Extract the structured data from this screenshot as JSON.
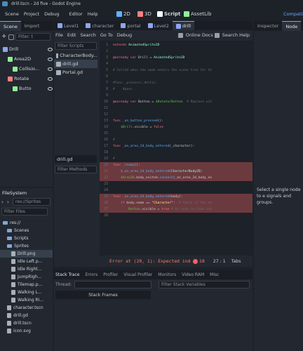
{
  "window": {
    "title": "drill.tscn - 2d five - Godot Engine"
  },
  "menu": [
    "Scene",
    "Project",
    "Debug",
    "Editor",
    "Help"
  ],
  "workspaces": [
    {
      "label": "2D",
      "color": "#5fb2ff"
    },
    {
      "label": "3D",
      "color": "#fc7f7f"
    },
    {
      "label": "Script",
      "color": "#ffffff"
    },
    {
      "label": "AssetLib",
      "color": "#8eef97"
    }
  ],
  "renderer": "Compatibi",
  "scene_dock": {
    "tabs": [
      "Scene",
      "Import"
    ],
    "filter_placeholder": "Filter: t",
    "nodes": [
      {
        "name": "Drill",
        "indent": 0,
        "color": "#8da5f3"
      },
      {
        "name": "Area2D",
        "indent": 1,
        "color": "#8eef97"
      },
      {
        "name": "Collisio...",
        "indent": 2,
        "color": "#8eef97"
      },
      {
        "name": "Rotate",
        "indent": 1,
        "color": "#fc7f7f"
      },
      {
        "name": "Butto",
        "indent": 2,
        "color": "#8eef97"
      }
    ]
  },
  "filesystem": {
    "title": "FileSystem",
    "path": "res://Sprites",
    "filter_placeholder": "Filter Files",
    "items": [
      {
        "name": "res://",
        "indent": 0,
        "kind": "folder"
      },
      {
        "name": "Scenes",
        "indent": 1,
        "kind": "folder"
      },
      {
        "name": "Scripts",
        "indent": 1,
        "kind": "folder"
      },
      {
        "name": "Sprites",
        "indent": 1,
        "kind": "folder"
      },
      {
        "name": "Drill.png",
        "indent": 2,
        "kind": "file",
        "selected": true
      },
      {
        "name": "Idle Left.p...",
        "indent": 2,
        "kind": "file"
      },
      {
        "name": "Idle Right...",
        "indent": 2,
        "kind": "file"
      },
      {
        "name": "JumpRigh...",
        "indent": 2,
        "kind": "file"
      },
      {
        "name": "Tilemap.p...",
        "indent": 2,
        "kind": "file"
      },
      {
        "name": "Walking L...",
        "indent": 2,
        "kind": "file"
      },
      {
        "name": "Walking Ri...",
        "indent": 2,
        "kind": "file"
      },
      {
        "name": "character.tscn",
        "indent": 1,
        "kind": "file"
      },
      {
        "name": "drill.gd",
        "indent": 1,
        "kind": "file"
      },
      {
        "name": "drill.tscn",
        "indent": 1,
        "kind": "file"
      },
      {
        "name": "icon.svg",
        "indent": 1,
        "kind": "file"
      }
    ]
  },
  "scene_tabs": [
    "Level1",
    "character",
    "portal",
    "Level2",
    "drill"
  ],
  "script_menu": [
    "File",
    "Edit",
    "Search",
    "Go To",
    "Debug"
  ],
  "online_docs": "Online Docs",
  "search_help": "Search Help",
  "filter_scripts": "Filter Scripts",
  "scripts": [
    {
      "name": "CharacterBody..."
    },
    {
      "name": "drill.gd",
      "selected": true
    },
    {
      "name": "Portal.gd"
    }
  ],
  "current_script": "drill.gd",
  "filter_methods": "Filter Methods",
  "code_lines": [
    {
      "n": "1",
      "html": "<span class='kw'>extends</span> <span class='ty'>AnimatedSprite2D</span>"
    },
    {
      "n": "2",
      "html": ""
    },
    {
      "n": "3",
      "html": "<span class='kw'>@onready</span> <span class='kw'>var</span> Drill = <span class='ty'>AnimatedSprite2D</span>"
    },
    {
      "n": "4",
      "html": ""
    },
    {
      "n": "5",
      "html": "<span class='cm'># Called when the node enters the scene tree for th</span>"
    },
    {
      "n": "6",
      "html": ""
    },
    {
      "n": "7",
      "html": "<span class='cm'>#func _process(_delta):</span>"
    },
    {
      "n": "8",
      "html": "<span class='cm'>#    #pass</span>"
    },
    {
      "n": "9",
      "html": ""
    },
    {
      "n": "10",
      "html": "<span class='kw'>@onready</span> <span class='kw'>var</span> Button = <span class='nd'>$Rotate/Button</span>  <span class='cm'># Replace wit</span>"
    },
    {
      "n": "11",
      "html": ""
    },
    {
      "n": "12",
      "html": ""
    },
    {
      "n": "13",
      "html": "<span class='kw'>func</span> <span class='fn'>_on_button_pressed</span>():"
    },
    {
      "n": "14",
      "html": "    <span class='nd'>$Drill</span>.visible = <span class='kw'>false</span>"
    },
    {
      "n": "15",
      "html": ""
    },
    {
      "n": "16",
      "html": "<span class='cm'>#</span>"
    },
    {
      "n": "17",
      "html": "<span class='kw'>func</span> <span class='fn'>_on_area_2d_body_entered</span>(_character):"
    },
    {
      "n": "18",
      "html": ""
    },
    {
      "n": "19",
      "html": "<span class='cm'>#</span>"
    },
    {
      "n": "20",
      "html": "<span class='kw'>func</span> <span class='fn'>_ready</span>():",
      "error": true
    },
    {
      "n": "21",
      "html": "    <span class='fn'>$_on_area_2d_body_entered</span>(<span class='ty'>CharacterBody2D</span>)",
      "error": true
    },
    {
      "n": "22",
      "html": "    <span class='nd'>$Area2D</span>.body_exited.<span class='fn'>connect</span>(_on_area_2d_body_ex",
      "error": true
    },
    {
      "n": "23",
      "html": ""
    },
    {
      "n": "24",
      "html": ""
    },
    {
      "n": "25",
      "html": "<span class='kw'>func</span> <span class='fn'>_on_area_2d_body_entered</span>(body):",
      "error": true
    },
    {
      "n": "26",
      "html": "    <span class='kw'>if</span> body.name == <span class='str'>\"Character\"</span>:  <span class='cm'># Check if the en</span>",
      "error": true
    },
    {
      "n": "27",
      "html": "        <span class='nd'>Button</span>.visible = <span class='kw'>true</span> <span class='cm'># Or node_to_hide.hid</span>",
      "error": true
    },
    {
      "n": "28",
      "html": ""
    }
  ],
  "status": {
    "error": "Error at (20, 1): Expected ind",
    "errors": "18",
    "position": "27 :  1",
    "indent": "Tabs"
  },
  "bottom_tabs": [
    "Stack Trace",
    "Errors",
    "Profiler",
    "Visual Profiler",
    "Monitors",
    "Video RAM",
    "Misc"
  ],
  "debugger": {
    "thread_label": "Thread:",
    "stack_frames": "Stack Frames",
    "filter_stack": "Filter Stack Variables"
  },
  "inspector": {
    "tabs": [
      "Inspector",
      "Node"
    ],
    "message": "Select a single node to e signals and groups."
  }
}
